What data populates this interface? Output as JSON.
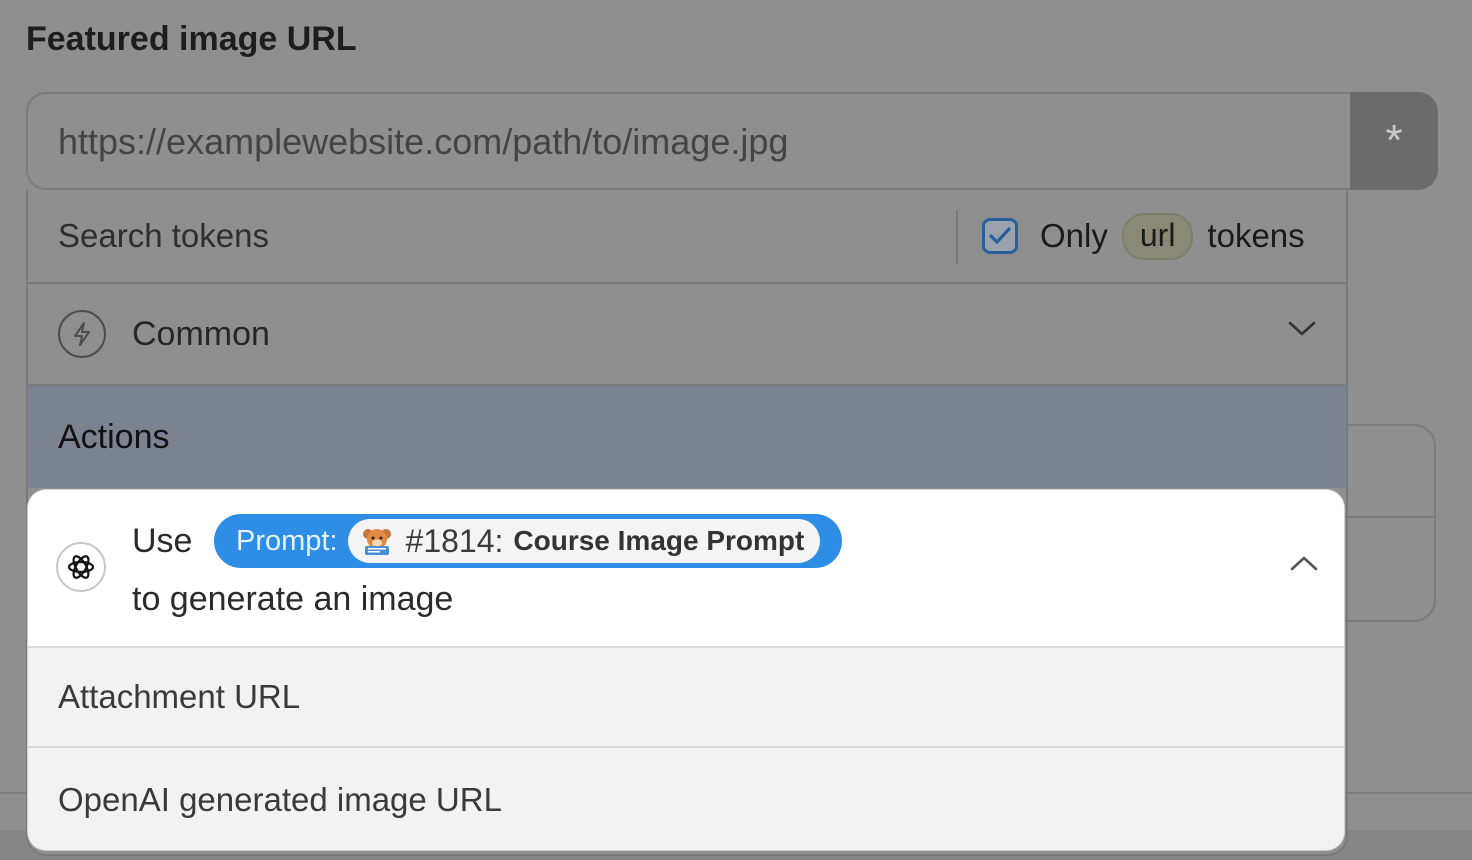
{
  "field": {
    "label": "Featured image URL",
    "placeholder": "https://examplewebsite.com/path/to/image.jpg",
    "value": "",
    "token_button_symbol": "*"
  },
  "tokens_dropdown": {
    "search_placeholder": "Search tokens",
    "only_filter": {
      "checked": true,
      "prefix": "Only",
      "chip": "url",
      "suffix": "tokens"
    },
    "groups": [
      {
        "label": "Common",
        "icon": "bolt-icon",
        "expanded": false
      },
      {
        "label": "Actions",
        "highlighted": true
      }
    ],
    "action": {
      "icon": "openai-icon",
      "prefix": "Use",
      "prompt": {
        "label": "Prompt:",
        "icon": "bear-mascot-icon",
        "number": "#1814:",
        "name": "Course Image Prompt"
      },
      "suffix": "to generate an image",
      "expanded": true,
      "items": [
        {
          "label": "Attachment URL"
        },
        {
          "label": "OpenAI generated image URL"
        }
      ]
    }
  },
  "colors": {
    "accent": "#2e8ee6",
    "overlay": "#8f8f8f",
    "actions_highlight": "#7b8290",
    "checkbox_border": "#2a5e9c"
  }
}
